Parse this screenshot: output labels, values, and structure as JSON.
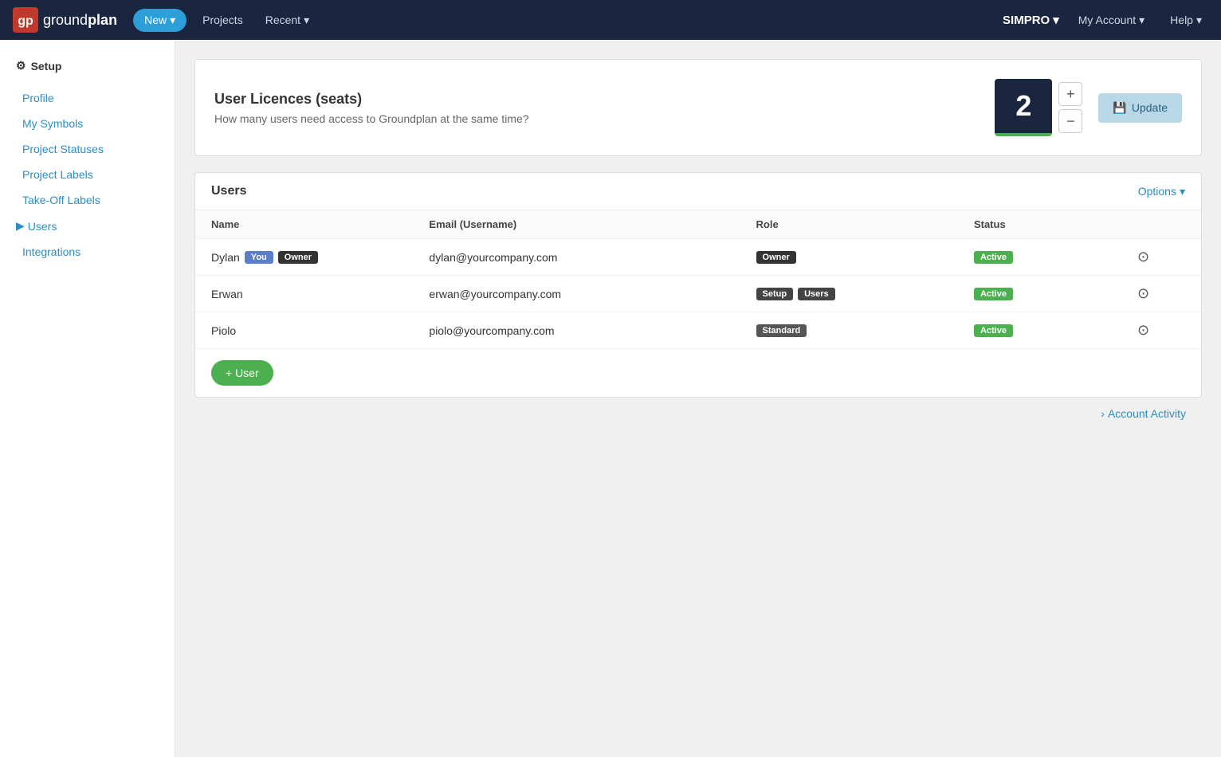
{
  "topnav": {
    "logo_text_light": "ground",
    "logo_text_bold": "plan",
    "new_label": "New",
    "projects_label": "Projects",
    "recent_label": "Recent",
    "simpro_label": "SIMPRO",
    "my_account_label": "My Account",
    "help_label": "Help"
  },
  "sidebar": {
    "section_title": "Setup",
    "links": [
      {
        "label": "Profile",
        "key": "profile"
      },
      {
        "label": "My Symbols",
        "key": "my-symbols"
      },
      {
        "label": "Project Statuses",
        "key": "project-statuses"
      },
      {
        "label": "Project Labels",
        "key": "project-labels"
      },
      {
        "label": "Take-Off Labels",
        "key": "take-off-labels"
      }
    ],
    "expandable": {
      "label": "Users",
      "key": "users"
    },
    "integrations_label": "Integrations"
  },
  "licence": {
    "title": "User Licences (seats)",
    "description": "How many users need access to Groundplan at the same time?",
    "count": "2",
    "plus_label": "+",
    "minus_label": "−",
    "update_label": "Update"
  },
  "users_table": {
    "section_title": "Users",
    "options_label": "Options",
    "columns": [
      "Name",
      "Email (Username)",
      "Role",
      "Status",
      ""
    ],
    "rows": [
      {
        "name": "Dylan",
        "badges": [
          "You",
          "Owner"
        ],
        "email": "dylan@yourcompany.com",
        "roles": [
          "Owner"
        ],
        "status": "Active"
      },
      {
        "name": "Erwan",
        "badges": [],
        "email": "erwan@yourcompany.com",
        "roles": [
          "Setup",
          "Users"
        ],
        "status": "Active"
      },
      {
        "name": "Piolo",
        "badges": [],
        "email": "piolo@yourcompany.com",
        "roles": [
          "Standard"
        ],
        "status": "Active"
      }
    ],
    "add_user_label": "+ User"
  },
  "account_activity": {
    "label": "Account Activity"
  }
}
